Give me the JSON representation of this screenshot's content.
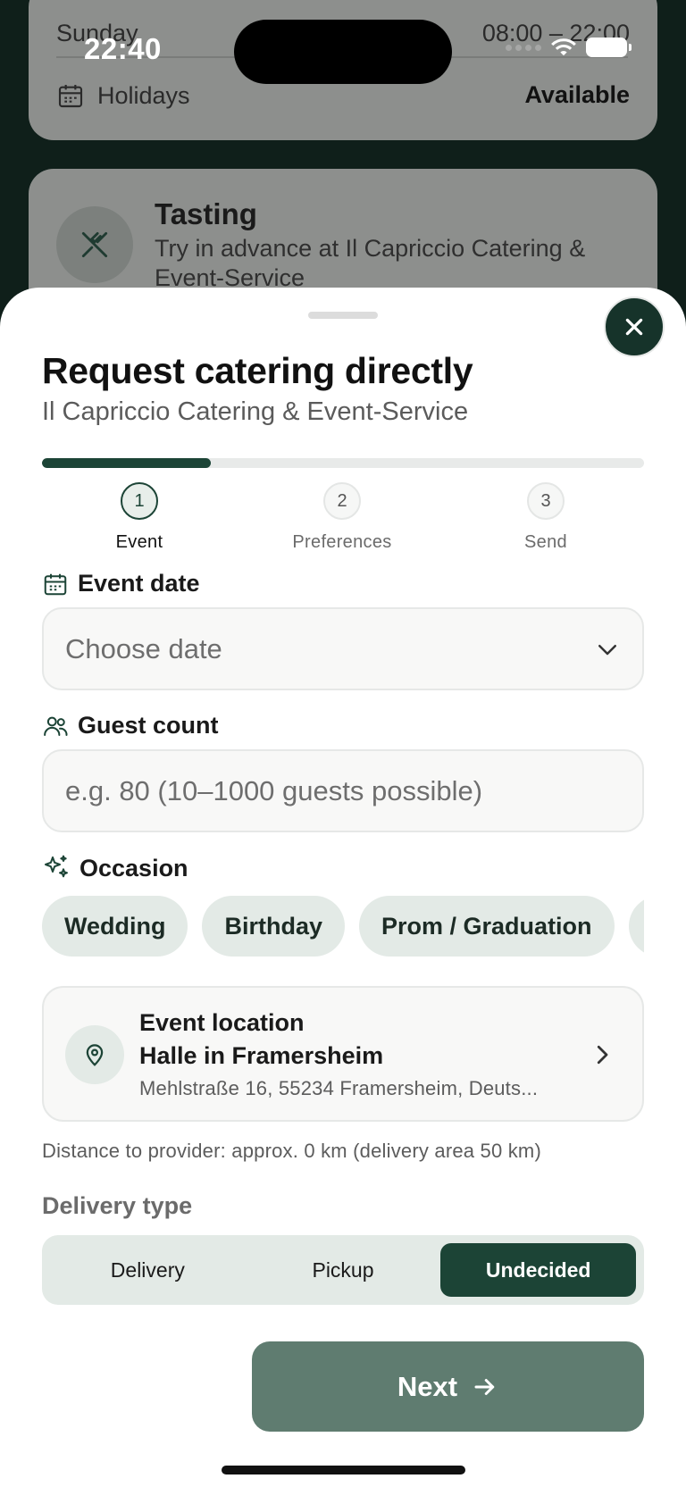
{
  "status_bar": {
    "time": "22:40"
  },
  "background": {
    "hours_day": "Sunday",
    "hours_time": "08:00 – 22:00",
    "holidays_label": "Holidays",
    "holidays_value": "Available",
    "tasting_title": "Tasting",
    "tasting_subtitle": "Try in advance at Il Capriccio Catering & Event-Service"
  },
  "sheet": {
    "title": "Request catering directly",
    "subtitle": "Il Capriccio Catering & Event-Service",
    "progress_fraction": 0.28,
    "steps": [
      {
        "number": "1",
        "label": "Event",
        "active": true
      },
      {
        "number": "2",
        "label": "Preferences",
        "active": false
      },
      {
        "number": "3",
        "label": "Send",
        "active": false
      }
    ],
    "event_date": {
      "label": "Event date",
      "placeholder": "Choose date"
    },
    "guest_count": {
      "label": "Guest count",
      "placeholder": "e.g. 80 (10–1000 guests possible)"
    },
    "occasion": {
      "label": "Occasion",
      "chips": [
        "Wedding",
        "Birthday",
        "Prom / Graduation",
        ""
      ]
    },
    "location": {
      "label": "Event location",
      "name": "Halle in Framersheim",
      "address": "Mehlstraße 16, 55234 Framersheim, Deuts..."
    },
    "distance_text": "Distance to provider: approx. 0 km (delivery area 50 km)",
    "delivery": {
      "label": "Delivery type",
      "options": [
        "Delivery",
        "Pickup",
        "Undecided"
      ],
      "selected": "Undecided"
    },
    "next_label": "Next"
  },
  "colors": {
    "accent": "#1c4436",
    "next_button": "#5f7c70",
    "chip_bg": "#e3eae6"
  }
}
